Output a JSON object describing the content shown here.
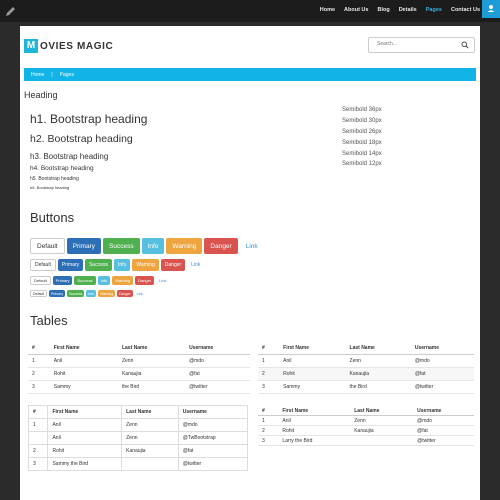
{
  "nav": {
    "items": [
      "Home",
      "About Us",
      "Blog",
      "Details",
      "Pages",
      "Contact Us"
    ],
    "active": "Pages"
  },
  "brand": {
    "letter": "M",
    "name": "OVIES MAGIC"
  },
  "search": {
    "placeholder": "Search..."
  },
  "breadcrumb": [
    "Home",
    "|",
    "Pages"
  ],
  "headings": {
    "section_title": "Heading",
    "items": [
      "h1. Bootstrap heading",
      "h2. Bootstrap heading",
      "h3. Bootstrap heading",
      "h4. Bootstrap heading",
      "h5. Bootstrap heading",
      "h6. Bootstrap heading"
    ],
    "sizes": [
      "Semibold 36px",
      "Semibold 30px",
      "Semibold 26px",
      "Semibold 18px",
      "Semibold 14px",
      "Semibold 12px"
    ]
  },
  "buttons": {
    "section_title": "Buttons",
    "labels": [
      "Default",
      "Primary",
      "Success",
      "Info",
      "Warning",
      "Danger",
      "Link"
    ]
  },
  "tables": {
    "section_title": "Tables",
    "headers": [
      "#",
      "First Name",
      "Last Name",
      "Username"
    ],
    "simple_rows": [
      [
        "1",
        "Anil",
        "Zenn",
        "@mdo"
      ],
      [
        "2",
        "Rohit",
        "Kanaujia",
        "@fat"
      ],
      [
        "3",
        "Sammy",
        "the Bird",
        "@twitter"
      ]
    ],
    "bordered_rows": [
      [
        "1",
        "Anil",
        "Zenn",
        "@mdo"
      ],
      [
        "",
        "Anil",
        "Zenn",
        "@TwBootstrap"
      ],
      [
        "2",
        "Rohit",
        "Kanaujia",
        "@fat"
      ],
      [
        "3",
        "Sammy the Bird",
        "",
        "@twitter"
      ]
    ],
    "striped_rows": [
      [
        "1",
        "Anil",
        "Zenn",
        "@mdo"
      ],
      [
        "2",
        "Rohit",
        "Kanaujia",
        "@fat"
      ],
      [
        "3",
        "Larry the Bird",
        "",
        "@twitter"
      ]
    ]
  },
  "colors": {
    "accent": "#12b4e8",
    "topbar": "#1c1c1c",
    "primary": "#2d6fb6",
    "success": "#50b050",
    "info": "#57bfe0",
    "warning": "#eea540",
    "danger": "#d9534f"
  }
}
